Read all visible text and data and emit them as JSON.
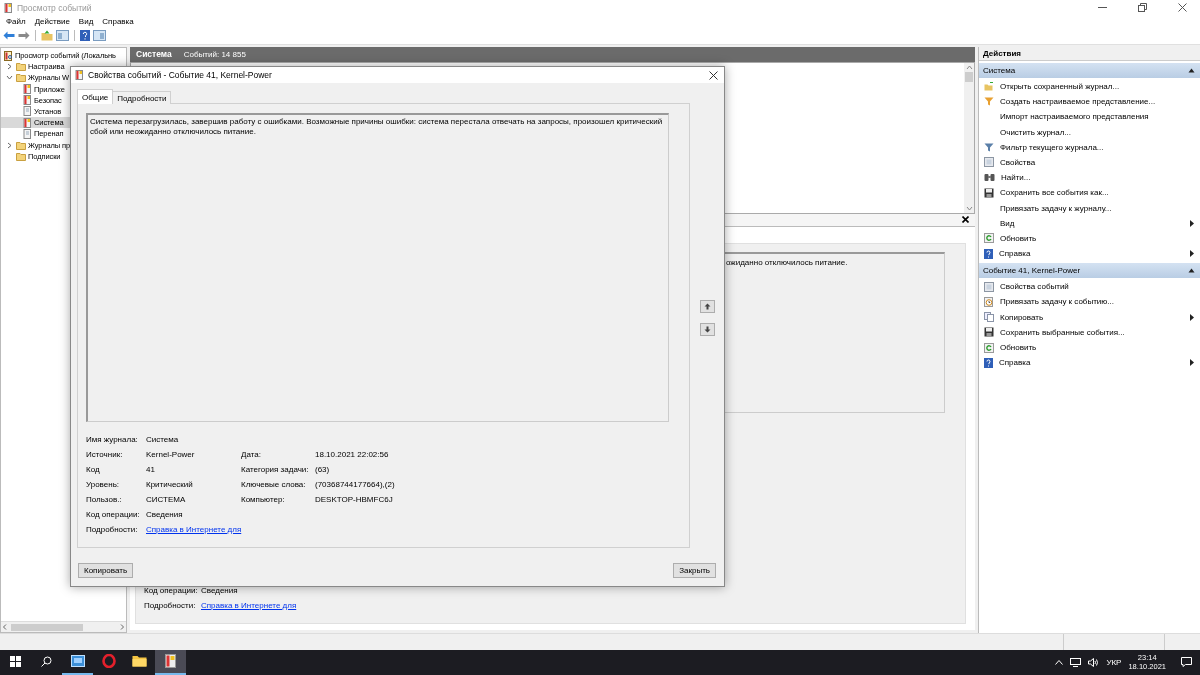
{
  "window": {
    "title": "Просмотр событий"
  },
  "menu": [
    "Файл",
    "Действие",
    "Вид",
    "Справка"
  ],
  "tree": [
    {
      "label": "Просмотр событий (Локальнь",
      "kind": "viewer",
      "selected": false,
      "children": [
        {
          "label": "Настраива",
          "kind": "folder",
          "selected": false,
          "expanded": false
        },
        {
          "label": "Журналы W",
          "kind": "folder",
          "selected": false,
          "expanded": true,
          "children": [
            {
              "label": "Приложе",
              "kind": "log",
              "selected": false
            },
            {
              "label": "Безопас",
              "kind": "log",
              "selected": false
            },
            {
              "label": "Установ",
              "kind": "log-plain",
              "selected": false
            },
            {
              "label": "Система",
              "kind": "log",
              "selected": true
            },
            {
              "label": "Перенап",
              "kind": "log-plain",
              "selected": false
            }
          ]
        },
        {
          "label": "Журналы пр",
          "kind": "folder",
          "selected": false,
          "expanded": false
        },
        {
          "label": "Подписки",
          "kind": "folder",
          "selected": false
        }
      ]
    }
  ],
  "events_pane": {
    "title": "Система",
    "count": "Событий: 14 855"
  },
  "preview": {
    "text": "ожиданно отключилось питание.",
    "fields": [
      {
        "label": "Код операции:",
        "value": "Сведения",
        "kind": "text"
      },
      {
        "label": "Подробности:",
        "value": "Справка в Интернете для",
        "kind": "link"
      }
    ]
  },
  "actions": {
    "title": "Действия",
    "sections": [
      {
        "title": "Система",
        "expanded": true,
        "items": [
          {
            "label": "Открыть сохраненный журнал...",
            "kind": "open",
            "submenu": false
          },
          {
            "label": "Создать настраиваемое представление...",
            "kind": "filter",
            "submenu": false
          },
          {
            "label": "Импорт настраиваемого представления",
            "kind": "none",
            "submenu": false
          },
          {
            "label": "Очистить журнал...",
            "kind": "none",
            "submenu": false
          },
          {
            "label": "Фильтр текущего журнала...",
            "kind": "filter-gray",
            "submenu": false
          },
          {
            "label": "Свойства",
            "kind": "props",
            "submenu": false
          },
          {
            "label": "Найти...",
            "kind": "find",
            "submenu": false
          },
          {
            "label": "Сохранить все события как...",
            "kind": "save",
            "submenu": false
          },
          {
            "label": "Привязать задачу к журналу...",
            "kind": "none",
            "submenu": false
          },
          {
            "label": "Вид",
            "kind": "none",
            "submenu": true
          },
          {
            "label": "Обновить",
            "kind": "refresh",
            "submenu": false
          },
          {
            "label": "Справка",
            "kind": "help",
            "submenu": true
          }
        ]
      },
      {
        "title": "Событие 41, Kernel-Power",
        "expanded": true,
        "items": [
          {
            "label": "Свойства событий",
            "kind": "props",
            "submenu": false
          },
          {
            "label": "Привязать задачу к событию...",
            "kind": "task",
            "submenu": false
          },
          {
            "label": "Копировать",
            "kind": "copy",
            "submenu": true
          },
          {
            "label": "Сохранить выбранные события...",
            "kind": "save",
            "submenu": false
          },
          {
            "label": "Обновить",
            "kind": "refresh",
            "submenu": false
          },
          {
            "label": "Справка",
            "kind": "help",
            "submenu": true
          }
        ]
      }
    ]
  },
  "dialog": {
    "title": "Свойства событий - Событие 41, Kernel-Power",
    "tabs": [
      {
        "label": "Общие",
        "selected": true
      },
      {
        "label": "Подробности",
        "selected": false
      }
    ],
    "description": "Система перезагрузилась, завершив работу с ошибками. Возможные причины ошибки: система перестала отвечать на запросы, произошел критический сбой или неожиданно отключилось питание.",
    "rows": [
      [
        {
          "label": "Имя журнала:",
          "value": "Система",
          "kind": "text"
        }
      ],
      [
        {
          "label": "Источник:",
          "value": "Kernel-Power",
          "kind": "text"
        },
        {
          "label": "Дата:",
          "value": "18.10.2021 22:02:56",
          "kind": "text"
        }
      ],
      [
        {
          "label": "Код",
          "value": "41",
          "kind": "text"
        },
        {
          "label": "Категория задачи:",
          "value": "(63)",
          "kind": "text"
        }
      ],
      [
        {
          "label": "Уровень:",
          "value": "Критический",
          "kind": "text"
        },
        {
          "label": "Ключевые слова:",
          "value": "(70368744177664),(2)",
          "kind": "text"
        }
      ],
      [
        {
          "label": "Пользов.:",
          "value": "СИСТЕМА",
          "kind": "text"
        },
        {
          "label": "Компьютер:",
          "value": "DESKTOP-HBMFC6J",
          "kind": "text"
        }
      ],
      [
        {
          "label": "Код операции:",
          "value": "Сведения",
          "kind": "text"
        }
      ],
      [
        {
          "label": "Подробности:",
          "value": "Справка в Интернете для",
          "kind": "link"
        }
      ]
    ],
    "buttons": [
      "Копировать",
      "Закрыть"
    ]
  },
  "taskbar": {
    "apps": [
      {
        "kind": "window-app",
        "running": true,
        "selected": false
      },
      {
        "kind": "red-ring",
        "running": false,
        "selected": false
      },
      {
        "kind": "folder",
        "running": false,
        "selected": false
      },
      {
        "kind": "viewer",
        "running": true,
        "selected": true
      }
    ],
    "language": "УКР",
    "time": "23:14",
    "date": "18.10.2021"
  }
}
